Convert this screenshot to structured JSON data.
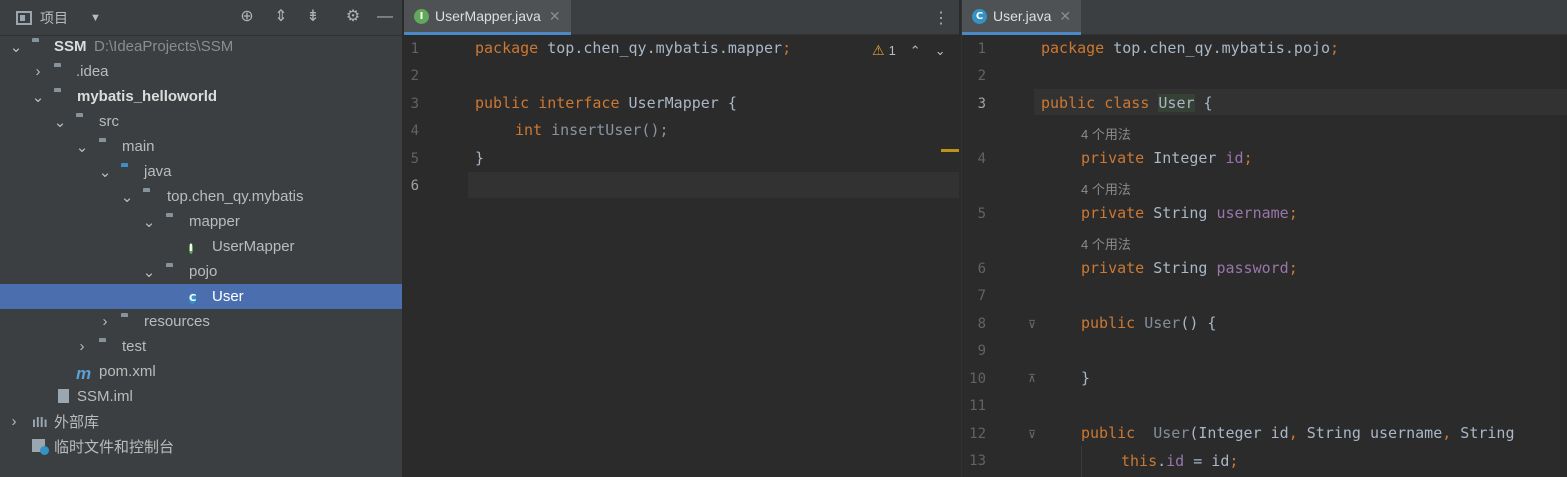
{
  "project_panel": {
    "title": "项目",
    "tree": [
      {
        "label": "SSM",
        "path": "D:\\IdeaProjects\\SSM",
        "bold": true
      },
      {
        "label": ".idea"
      },
      {
        "label": "mybatis_helloworld",
        "bold": true
      },
      {
        "label": "src"
      },
      {
        "label": "main"
      },
      {
        "label": "java"
      },
      {
        "label": "top.chen_qy.mybatis"
      },
      {
        "label": "mapper"
      },
      {
        "label": "UserMapper"
      },
      {
        "label": "pojo"
      },
      {
        "label": "User"
      },
      {
        "label": "resources"
      },
      {
        "label": "test"
      },
      {
        "label": "pom.xml"
      },
      {
        "label": "SSM.iml"
      },
      {
        "label": "外部库"
      },
      {
        "label": "临时文件和控制台"
      }
    ]
  },
  "editor_left": {
    "tab": {
      "label": "UserMapper.java",
      "icon_letter": "I"
    },
    "warning_count": "1",
    "line_numbers": [
      "1",
      "2",
      "3",
      "4",
      "5",
      "6"
    ],
    "lines": {
      "l1_kw": "package",
      "l1_rest": " top.chen_qy.mybatis.mapper",
      "l3_kw1": "public",
      "l3_kw2": "interface",
      "l3_rest": " UserMapper {",
      "l4_kw": "int",
      "l4_rest": " insertUser();",
      "l5": "}"
    }
  },
  "editor_right": {
    "tab": {
      "label": "User.java",
      "icon_letter": "C"
    },
    "line_numbers": [
      "1",
      "2",
      "3",
      "4",
      "5",
      "6",
      "7",
      "8",
      "9",
      "10",
      "11",
      "12",
      "13"
    ],
    "usage_hint": "4 个用法",
    "lines": {
      "l1_kw": "package",
      "l1_rest": " top.chen_qy.mybatis.pojo",
      "l3_kw1": "public",
      "l3_kw2": "class",
      "l3_cls": "User",
      "l3_rest": " {",
      "l4_kw": "private",
      "l4_type": " Integer ",
      "l4_field": "id",
      "l5_kw": "private",
      "l5_type": " String ",
      "l5_field": "username",
      "l6_kw": "private",
      "l6_type": " String ",
      "l6_field": "password",
      "l8_kw": "public",
      "l8_rest": "User() {",
      "l10": "}",
      "l12_kw": "public",
      "l12_rest": "User(Integer id, String username, String",
      "l13_kw": "this",
      "l13_rest": ".id = id;"
    }
  },
  "colors": {
    "panel": "#3c3f41",
    "editor": "#2b2b2b",
    "selection": "#4b6eaf",
    "keyword": "#cc7832",
    "field": "#9876aa"
  }
}
